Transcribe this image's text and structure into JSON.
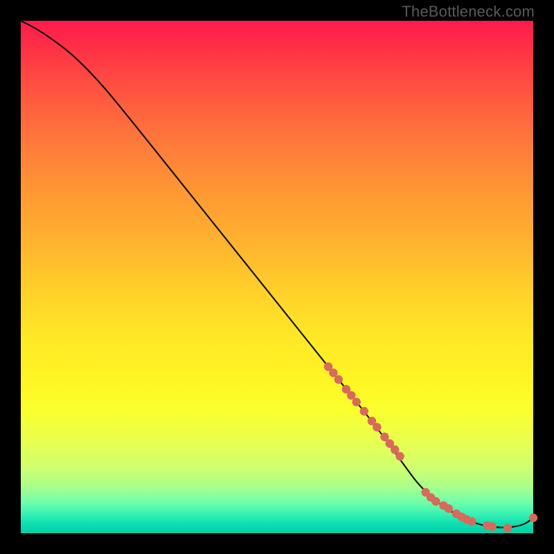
{
  "watermark": {
    "text": "TheBottleneck.com"
  },
  "chart_data": {
    "type": "line",
    "title": "",
    "xlabel": "",
    "ylabel": "",
    "xlim": [
      0,
      100
    ],
    "ylim": [
      0,
      100
    ],
    "curve": {
      "x": [
        0,
        3,
        6,
        10,
        15,
        20,
        30,
        40,
        50,
        60,
        70,
        75,
        78,
        82,
        86,
        90,
        94,
        98,
        100
      ],
      "y": [
        100,
        98.5,
        96.5,
        93.5,
        88.5,
        82.5,
        70,
        57.5,
        45,
        32.5,
        20,
        13,
        9,
        5.5,
        3,
        1.5,
        1,
        1.5,
        3
      ],
      "name": "bottleneck-curve",
      "color": "#111111",
      "width": 2.2
    },
    "highlight_points": {
      "color": "#d86a5c",
      "radius": 6.2,
      "x": [
        60,
        61,
        62,
        63.5,
        64.5,
        65.5,
        67,
        68.5,
        69.5,
        71,
        72,
        73,
        74,
        79,
        80,
        81,
        82.5,
        83.5,
        85,
        86,
        87,
        88,
        91,
        92,
        95,
        100
      ],
      "y": [
        32.5,
        31.3,
        30,
        28.1,
        26.9,
        25.6,
        23.8,
        21.9,
        20.7,
        18.8,
        17.5,
        16.3,
        15,
        8,
        7,
        6.2,
        5.4,
        4.8,
        3.8,
        3.2,
        2.7,
        2.3,
        1.5,
        1.3,
        1.0,
        3
      ]
    }
  }
}
